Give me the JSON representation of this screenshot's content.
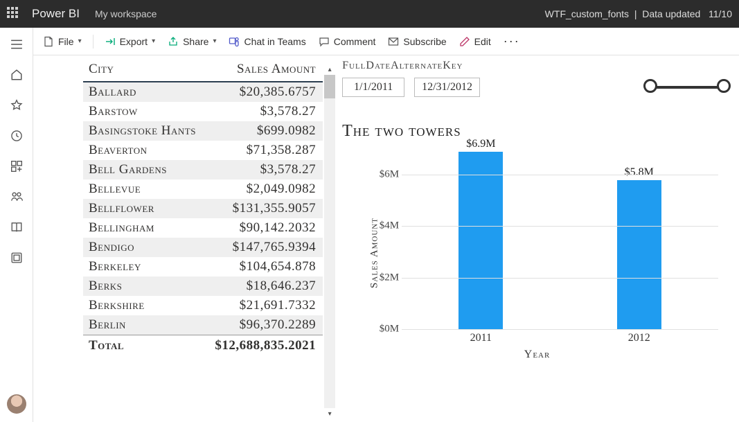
{
  "header": {
    "brand": "Power BI",
    "workspace": "My workspace",
    "report_name": "WTF_custom_fonts",
    "updated_prefix": "Data updated",
    "updated_date": "11/10"
  },
  "toolbar": {
    "file": "File",
    "export": "Export",
    "share": "Share",
    "chat": "Chat in Teams",
    "comment": "Comment",
    "subscribe": "Subscribe",
    "edit": "Edit"
  },
  "table": {
    "headers": {
      "city": "City",
      "amount": "Sales Amount"
    },
    "rows": [
      {
        "city": "Ballard",
        "amount": "$20,385.6757"
      },
      {
        "city": "Barstow",
        "amount": "$3,578.27"
      },
      {
        "city": "Basingstoke Hants",
        "amount": "$699.0982"
      },
      {
        "city": "Beaverton",
        "amount": "$71,358.287"
      },
      {
        "city": "Bell Gardens",
        "amount": "$3,578.27"
      },
      {
        "city": "Bellevue",
        "amount": "$2,049.0982"
      },
      {
        "city": "Bellflower",
        "amount": "$131,355.9057"
      },
      {
        "city": "Bellingham",
        "amount": "$90,142.2032"
      },
      {
        "city": "Bendigo",
        "amount": "$147,765.9394"
      },
      {
        "city": "Berkeley",
        "amount": "$104,654.878"
      },
      {
        "city": "Berks",
        "amount": "$18,646.237"
      },
      {
        "city": "Berkshire",
        "amount": "$21,691.7332"
      },
      {
        "city": "Berlin",
        "amount": "$96,370.2289"
      }
    ],
    "total_label": "Total",
    "total_value": "$12,688,835.2021"
  },
  "slicer": {
    "title": "FullDateAlternateKey",
    "start": "1/1/2011",
    "end": "12/31/2012"
  },
  "chart_data": {
    "type": "bar",
    "title": "The two towers",
    "xlabel": "Year",
    "ylabel": "Sales Amount",
    "ylim": [
      0,
      7
    ],
    "y_ticks": [
      {
        "v": 0,
        "label": "$0M"
      },
      {
        "v": 2,
        "label": "$2M"
      },
      {
        "v": 4,
        "label": "$4M"
      },
      {
        "v": 6,
        "label": "$6M"
      }
    ],
    "categories": [
      "2011",
      "2012"
    ],
    "series": [
      {
        "name": "Sales Amount",
        "values": [
          6.9,
          5.8
        ],
        "labels": [
          "$6.9M",
          "$5.8M"
        ]
      }
    ]
  }
}
